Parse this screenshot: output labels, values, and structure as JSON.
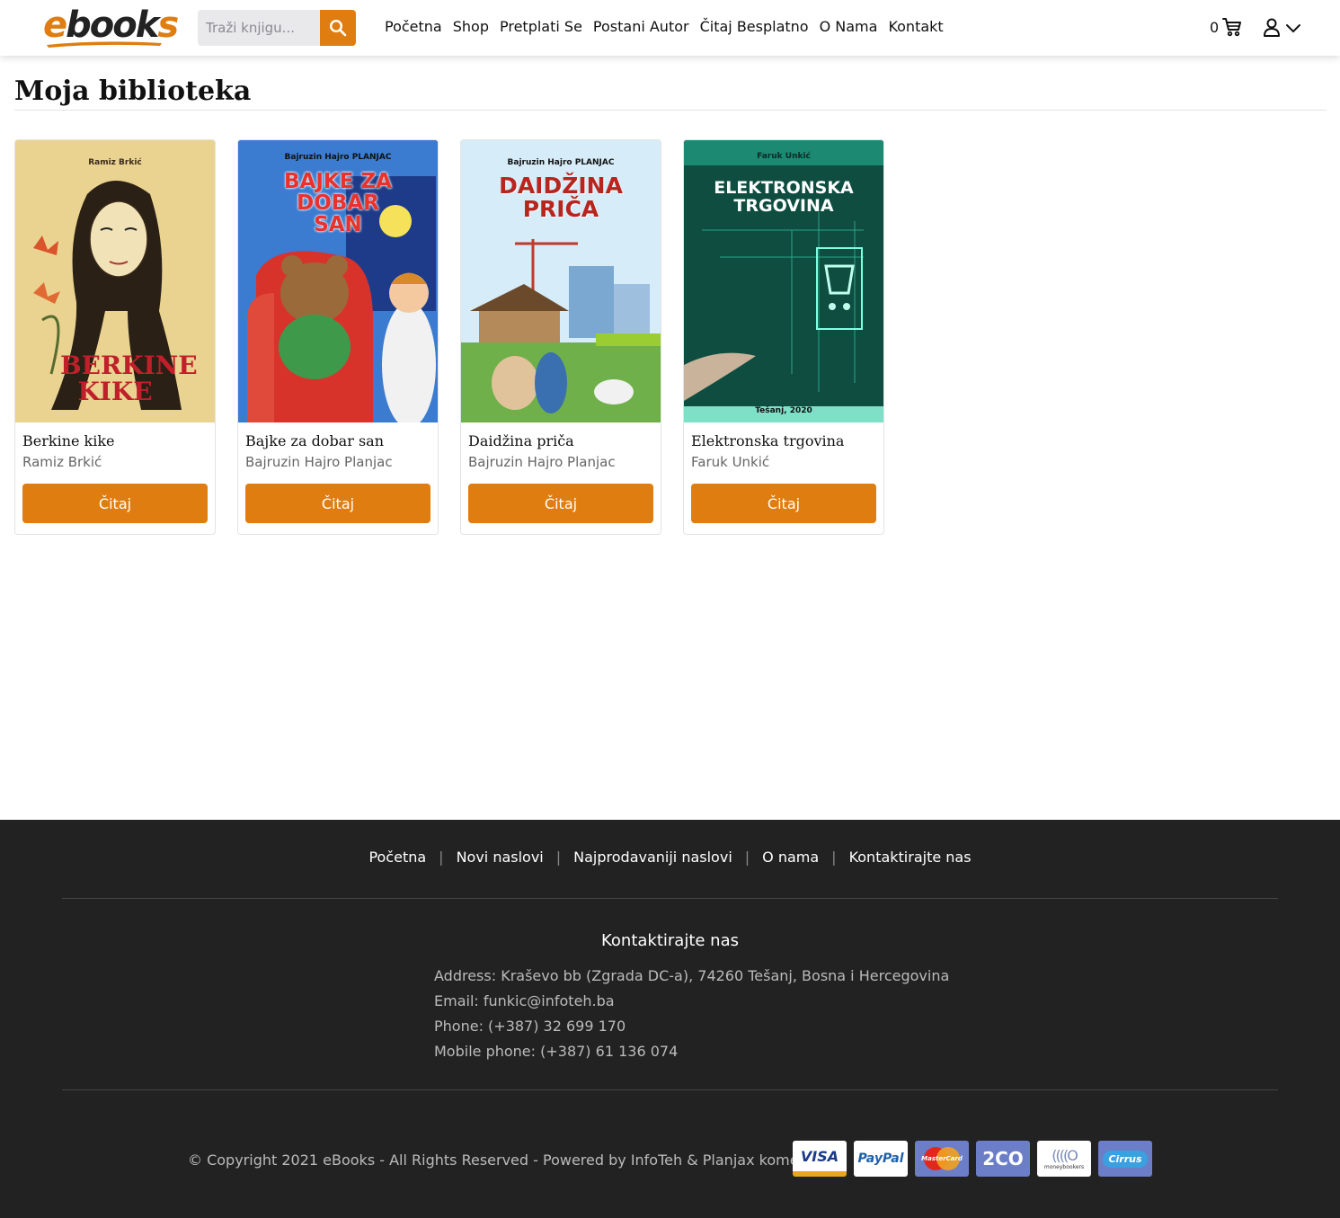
{
  "header": {
    "logo": "ebooks",
    "search": {
      "placeholder": "Traži knjigu...",
      "value": ""
    },
    "nav": [
      "Početna",
      "Shop",
      "Pretplati Se",
      "Postani Autor",
      "Čitaj Besplatno",
      "O Nama",
      "Kontakt"
    ],
    "cart_count": "0",
    "icons": {
      "search": "search-icon",
      "cart": "cart-icon",
      "user": "user-icon",
      "dropdown": "chevron-down-icon"
    }
  },
  "main": {
    "title": "Moja biblioteka",
    "books": [
      {
        "title": "Berkine kike",
        "author": "Ramiz Brkić",
        "button": "Čitaj",
        "cover_author": "Ramiz Brkić",
        "cover_title": "BERKINE KIKE"
      },
      {
        "title": "Bajke za dobar san",
        "author": "Bajruzin Hajro Planjac",
        "button": "Čitaj",
        "cover_author": "Bajruzin Hajro PLANJAC",
        "cover_title": "BAJKE ZA DOBAR SAN"
      },
      {
        "title": "Daidžina priča",
        "author": "Bajruzin Hajro Planjac",
        "button": "Čitaj",
        "cover_author": "Bajruzin Hajro PLANJAC",
        "cover_title": "DAIDŽINA PRIČA"
      },
      {
        "title": "Elektronska trgovina",
        "author": "Faruk Unkić",
        "button": "Čitaj",
        "cover_author": "Faruk Unkić",
        "cover_title": "ELEKTRONSKA TRGOVINA",
        "cover_year": "Tešanj, 2020"
      }
    ]
  },
  "footer": {
    "links": [
      "Početna",
      "Novi naslovi",
      "Najprodavaniji naslovi",
      "O nama",
      "Kontaktirajte nas"
    ],
    "contact_title": "Kontaktirajte nas",
    "address": "Address: Kraševo bb (Zgrada DC-a), 74260 Tešanj, Bosna i Hercegovina",
    "email": "Email: funkic@infoteh.ba",
    "phone": "Phone: (+387) 32 699 170",
    "mobile": "Mobile phone: (+387) 61 136 074",
    "copyright": "© Copyright 2021 eBooks - All Rights Reserved - Powered by InfoTeh & Planjax komerc",
    "payments": [
      "VISA",
      "PayPal",
      "MasterCard",
      "2CO",
      "moneybookers",
      "Cirrus"
    ]
  },
  "colors": {
    "accent": "#e07d10",
    "footer_bg": "#222222"
  }
}
